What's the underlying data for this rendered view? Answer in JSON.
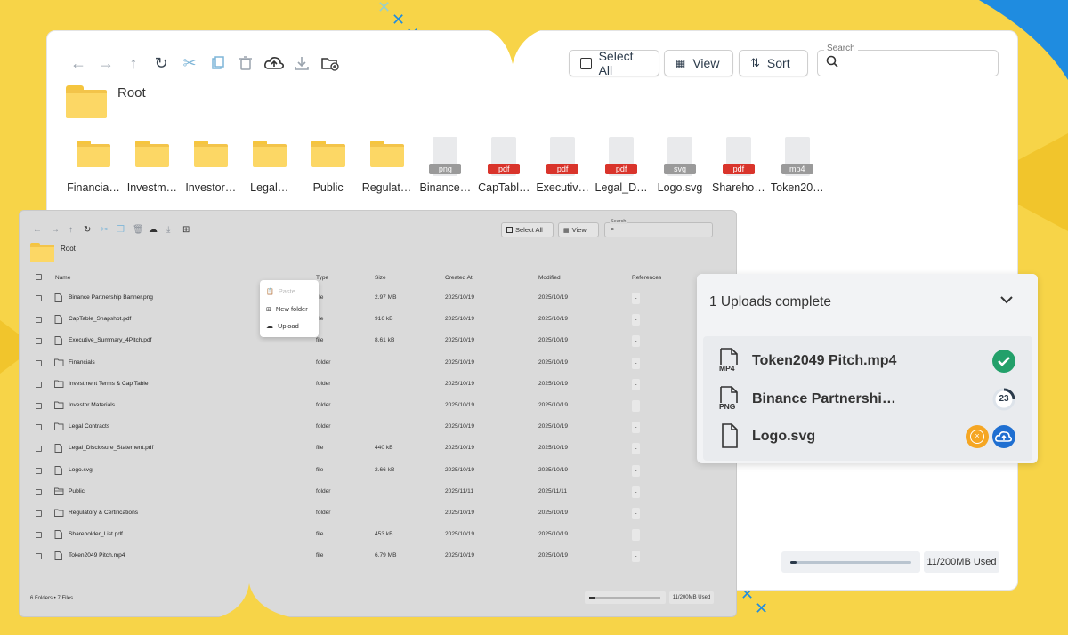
{
  "colors": {
    "background": "#f7d448",
    "accent": "#1f8ce0",
    "success": "#23a06a",
    "warning": "#f5a623",
    "pdf": "#d9342b",
    "neutral_tag": "#9a9a9a"
  },
  "main_window": {
    "toolbar": {
      "icons": [
        "back-arrow-icon",
        "forward-arrow-icon",
        "up-arrow-icon",
        "refresh-icon",
        "cut-icon",
        "copy-icon",
        "delete-icon",
        "cloud-upload-icon",
        "download-icon",
        "new-folder-icon"
      ],
      "select_all_label": "Select All",
      "view_label": "View",
      "sort_label": "Sort",
      "search_legend": "Search",
      "search_value": ""
    },
    "breadcrumb": {
      "title": "Root"
    },
    "grid_items": [
      {
        "label": "Financia…",
        "kind": "folder"
      },
      {
        "label": "Investm…",
        "kind": "folder"
      },
      {
        "label": "Investor…",
        "kind": "folder"
      },
      {
        "label": "Legal…",
        "kind": "folder"
      },
      {
        "label": "Public",
        "kind": "folder"
      },
      {
        "label": "Regulat…",
        "kind": "folder"
      },
      {
        "label": "Binance…",
        "kind": "file",
        "tag": "png"
      },
      {
        "label": "CapTabl…",
        "kind": "file",
        "tag": "pdf"
      },
      {
        "label": "Executiv…",
        "kind": "file",
        "tag": "pdf"
      },
      {
        "label": "Legal_D…",
        "kind": "file",
        "tag": "pdf"
      },
      {
        "label": "Logo.svg",
        "kind": "file",
        "tag": "svg"
      },
      {
        "label": "Shareho…",
        "kind": "file",
        "tag": "pdf"
      },
      {
        "label": "Token20…",
        "kind": "file",
        "tag": "mp4"
      }
    ],
    "storage": {
      "used_label": "11/200MB Used",
      "used_fraction": 0.055
    }
  },
  "list_window": {
    "toolbar": {
      "select_all_label": "Select All",
      "view_label": "View",
      "search_legend": "Search"
    },
    "breadcrumb": {
      "title": "Root"
    },
    "columns": {
      "name": "Name",
      "type": "Type",
      "size": "Size",
      "created": "Created At",
      "modified": "Modified",
      "references": "References"
    },
    "rows": [
      {
        "name": "Binance Partnership Banner.png",
        "type": "file",
        "size": "2.97 MB",
        "created": "2025/10/19",
        "modified": "2025/10/19",
        "ref": "-",
        "kind": "file"
      },
      {
        "name": "CapTable_Snapshot.pdf",
        "type": "file",
        "size": "916 kB",
        "created": "2025/10/19",
        "modified": "2025/10/19",
        "ref": "-",
        "kind": "file"
      },
      {
        "name": "Executive_Summary_4Pitch.pdf",
        "type": "file",
        "size": "8.61 kB",
        "created": "2025/10/19",
        "modified": "2025/10/19",
        "ref": "-",
        "kind": "file"
      },
      {
        "name": "Financials",
        "type": "folder",
        "size": "",
        "created": "2025/10/19",
        "modified": "2025/10/19",
        "ref": "-",
        "kind": "folder"
      },
      {
        "name": "Investment Terms & Cap Table",
        "type": "folder",
        "size": "",
        "created": "2025/10/19",
        "modified": "2025/10/19",
        "ref": "-",
        "kind": "folder"
      },
      {
        "name": "Investor Materials",
        "type": "folder",
        "size": "",
        "created": "2025/10/19",
        "modified": "2025/10/19",
        "ref": "-",
        "kind": "folder"
      },
      {
        "name": "Legal Contracts",
        "type": "folder",
        "size": "",
        "created": "2025/10/19",
        "modified": "2025/10/19",
        "ref": "-",
        "kind": "folder"
      },
      {
        "name": "Legal_Disclosure_Statement.pdf",
        "type": "file",
        "size": "440 kB",
        "created": "2025/10/19",
        "modified": "2025/10/19",
        "ref": "-",
        "kind": "file"
      },
      {
        "name": "Logo.svg",
        "type": "file",
        "size": "2.66 kB",
        "created": "2025/10/19",
        "modified": "2025/10/19",
        "ref": "-",
        "kind": "file"
      },
      {
        "name": "Public",
        "type": "folder",
        "size": "",
        "created": "2025/11/11",
        "modified": "2025/11/11",
        "ref": "-",
        "kind": "folder-open"
      },
      {
        "name": "Regulatory & Certifications",
        "type": "folder",
        "size": "",
        "created": "2025/10/19",
        "modified": "2025/10/19",
        "ref": "-",
        "kind": "folder"
      },
      {
        "name": "Shareholder_List.pdf",
        "type": "file",
        "size": "453 kB",
        "created": "2025/10/19",
        "modified": "2025/10/19",
        "ref": "-",
        "kind": "file"
      },
      {
        "name": "Token2049 Pitch.mp4",
        "type": "file",
        "size": "6.79 MB",
        "created": "2025/10/19",
        "modified": "2025/10/19",
        "ref": "-",
        "kind": "file"
      }
    ],
    "context_menu": {
      "paste": "Paste",
      "new_folder": "New folder",
      "upload": "Upload"
    },
    "footer": {
      "summary": "6 Folders • 7 Files",
      "used_label": "11/200MB Used"
    }
  },
  "uploads_panel": {
    "title": "1 Uploads complete",
    "items": [
      {
        "name": "Token2049 Pitch.mp4",
        "file_tag": "MP4",
        "status": "complete"
      },
      {
        "name": "Binance Partnershi…",
        "file_tag": "PNG",
        "status": "in-progress",
        "progress_label": "23"
      },
      {
        "name": "Logo.svg",
        "file_tag": "",
        "status": "pending"
      }
    ]
  }
}
